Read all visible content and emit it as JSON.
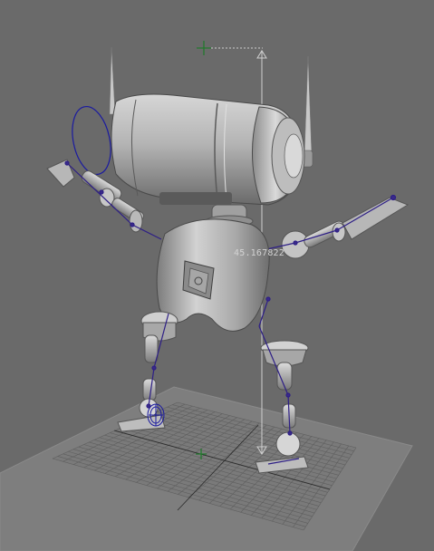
{
  "viewport": {
    "background": "#6a6a6a",
    "grid_color": "#7d7d7d",
    "grid_line_color": "#5b5b5b",
    "axis_color": "#1f7a2a"
  },
  "measure_tool": {
    "label": "45.167822",
    "color": "#c9c9c9",
    "locator_color": "#1f7a2a"
  },
  "model": {
    "name": "robot",
    "body_color": "#a8a8a8",
    "shadow_color": "#5a5a5a",
    "highlight_color": "#d8d8d8",
    "joint_color": "#3a2a8a",
    "ik_handle_color": "#2b2b9a"
  }
}
